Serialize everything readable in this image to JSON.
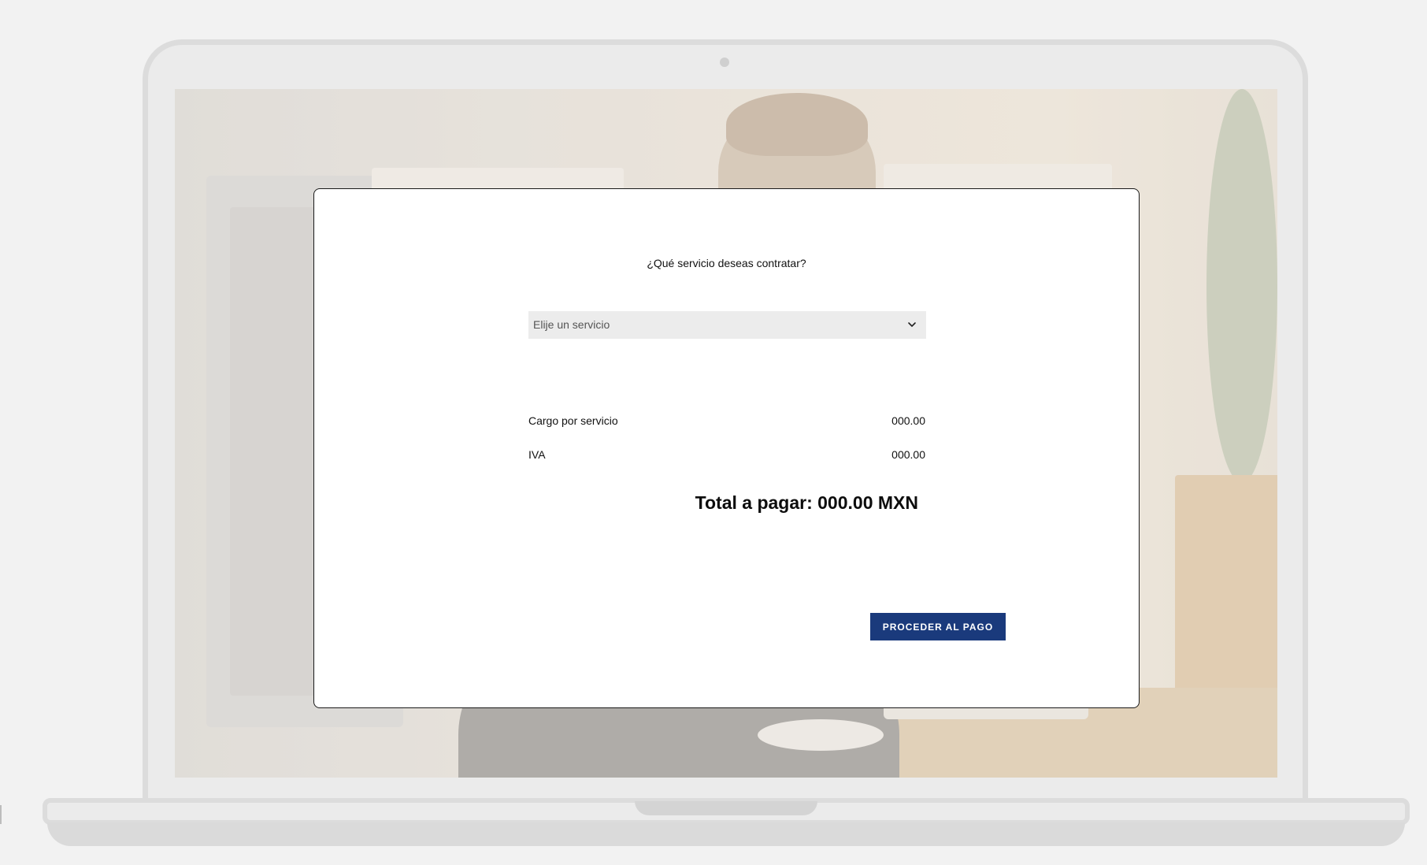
{
  "modal": {
    "question": "¿Qué servicio deseas contratar?",
    "service_select": {
      "selected": "Elije un servicio",
      "icon": "chevron-down-icon"
    },
    "summary": [
      {
        "label": "Cargo por servicio",
        "value": "000.00"
      },
      {
        "label": "IVA",
        "value": "000.00"
      }
    ],
    "total": "Total a pagar: 000.00 MXN",
    "pay_button": "PROCEDER AL PAGO"
  },
  "colors": {
    "accent": "#1a3a7c",
    "select_background": "#ececec",
    "page_background": "#f2f2f2"
  }
}
